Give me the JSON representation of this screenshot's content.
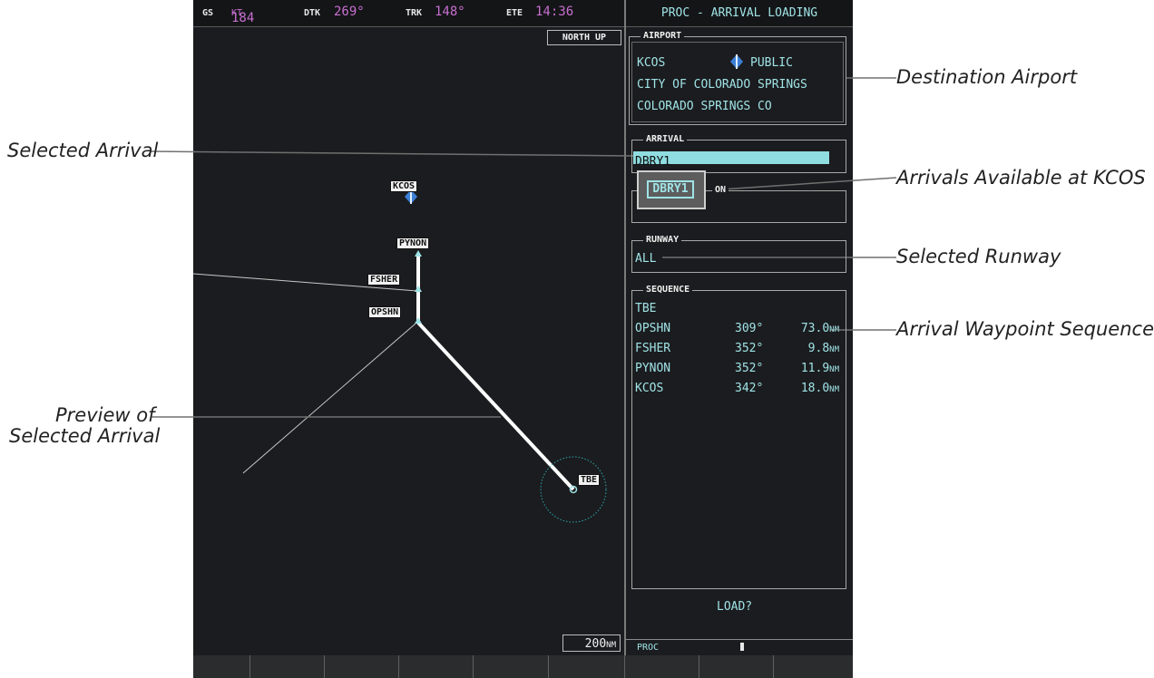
{
  "topbar": {
    "gs_label": "GS",
    "gs_value": "184",
    "gs_unit": "KT",
    "dtk_label": "DTK",
    "dtk_value": "269°",
    "trk_label": "TRK",
    "trk_value": "148°",
    "ete_label": "ETE",
    "ete_value": "14:36"
  },
  "proc_title": "PROC - ARRIVAL LOADING",
  "map": {
    "orientation": "NORTH UP",
    "range_value": "200",
    "range_unit": "NM",
    "waypoints": [
      "KCOS",
      "PYNON",
      "FSHER",
      "OPSHN",
      "TBE"
    ]
  },
  "airport": {
    "title": "AIRPORT",
    "id": "KCOS",
    "type": "PUBLIC",
    "name": "CITY OF COLORADO SPRINGS",
    "location": "COLORADO SPRINGS CO"
  },
  "arrival": {
    "title": "ARRIVAL",
    "selected": "DBRY1",
    "popup_option": "DBRY1",
    "transition_title_fragment": "ON"
  },
  "runway": {
    "title": "RUNWAY",
    "value": "ALL"
  },
  "sequence": {
    "title": "SEQUENCE",
    "start": "TBE",
    "rows": [
      {
        "wpt": "OPSHN",
        "crs": "309°",
        "dist": "73.0",
        "unit": "NM"
      },
      {
        "wpt": "FSHER",
        "crs": "352°",
        "dist": "9.8",
        "unit": "NM"
      },
      {
        "wpt": "PYNON",
        "crs": "352°",
        "dist": "11.9",
        "unit": "NM"
      },
      {
        "wpt": "KCOS",
        "crs": "342°",
        "dist": "18.0",
        "unit": "NM"
      }
    ]
  },
  "load_prompt": "LOAD?",
  "footer_label": "PROC",
  "callouts": {
    "destination_airport": "Destination Airport",
    "selected_arrival": "Selected Arrival",
    "arrivals_available": "Arrivals Available at KCOS",
    "selected_runway": "Selected Runway",
    "waypoint_sequence": "Arrival Waypoint Sequence",
    "preview_line1": "Preview of",
    "preview_line2": "Selected Arrival"
  },
  "colors": {
    "cyan": "#9fe3e6",
    "magenta": "#c86fd0",
    "background": "#1b1c1f",
    "airport_symbol": "#3d7fd6"
  }
}
